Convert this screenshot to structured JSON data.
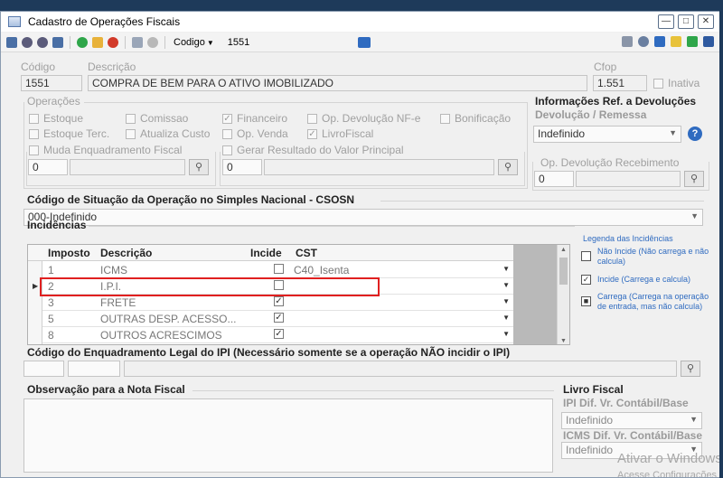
{
  "window": {
    "title": "Cadastro de Operações Fiscais",
    "controls": [
      "—",
      "□",
      "✕"
    ]
  },
  "toolbar": {
    "search_field": "Codigo",
    "search_value": "1551"
  },
  "header": {
    "codigo_label": "Código",
    "codigo_value": "1551",
    "descricao_label": "Descrição",
    "descricao_value": "COMPRA DE BEM PARA O ATIVO IMOBILIZADO",
    "cfop_label": "Cfop",
    "cfop_value": "1.551",
    "inativa_label": "Inativa"
  },
  "operacoes": {
    "title": "Operações",
    "checks": [
      {
        "label": "Estoque",
        "checked": false
      },
      {
        "label": "Comissao",
        "checked": false
      },
      {
        "label": "Financeiro",
        "checked": true
      },
      {
        "label": "Op.  Devolução NF-e",
        "checked": false
      },
      {
        "label": "Bonificação",
        "checked": false
      },
      {
        "label": "Estoque Terc.",
        "checked": false
      },
      {
        "label": "Atualiza Custo",
        "checked": false
      },
      {
        "label": "Op. Venda",
        "checked": false
      },
      {
        "label": "LivroFiscal",
        "checked": true
      }
    ],
    "muda_label": "Muda Enquadramento Fiscal",
    "muda_value": "0",
    "gerar_label": "Gerar Resultado do Valor Principal",
    "gerar_value": "0"
  },
  "devolucoes": {
    "title": "Informações Ref. a Devoluções",
    "devolucao_label": "Devolução / Remessa",
    "devolucao_value": "Indefinido",
    "op_label": "Op. Devolução Recebimento",
    "op_value": "0"
  },
  "csosn": {
    "title": "Código de Situação da Operação no Simples Nacional - CSOSN",
    "value": "000-Indefinido"
  },
  "incidencias": {
    "title": "Incidências",
    "columns": [
      "Imposto",
      "Descrição",
      "Incide",
      "CST"
    ],
    "rows": [
      {
        "imposto": "1",
        "descricao": "ICMS",
        "incide": false,
        "cst": "C40_Isenta"
      },
      {
        "imposto": "2",
        "descricao": "I.P.I.",
        "incide": false,
        "cst": ""
      },
      {
        "imposto": "3",
        "descricao": "FRETE",
        "incide": true,
        "cst": ""
      },
      {
        "imposto": "5",
        "descricao": "OUTRAS DESP. ACESSO...",
        "incide": true,
        "cst": ""
      },
      {
        "imposto": "8",
        "descricao": "OUTROS ACRESCIMOS",
        "incide": true,
        "cst": ""
      }
    ]
  },
  "legenda": {
    "title": "Legenda das Incidências",
    "items": [
      {
        "mark": "",
        "text": "Não Incide (Não carrega e não calcula)"
      },
      {
        "mark": "✓",
        "text": "Incide (Carrega e calcula)"
      },
      {
        "mark": "■",
        "text": "Carrega (Carrega na operação de entrada, mas não calcula)"
      }
    ]
  },
  "enquadramento": {
    "title": "Código do Enquadramento Legal do IPI (Necessário somente se a operação NÃO incidir o IPI)"
  },
  "observacao": {
    "title": "Observação para a Nota Fiscal"
  },
  "livro_fiscal": {
    "title": "Livro Fiscal",
    "ipi_label": "IPI Dif. Vr. Contábil/Base",
    "ipi_value": "Indefinido",
    "icms_label": "ICMS Dif. Vr. Contábil/Base",
    "icms_value": "Indefinido"
  },
  "watermark": {
    "line1": "Ativar o Windows",
    "line2": "Acesse Configurações"
  },
  "colors": {
    "accent": "#2f6bc0",
    "highlight": "#e02020",
    "desktop": "#1e3a5a"
  }
}
